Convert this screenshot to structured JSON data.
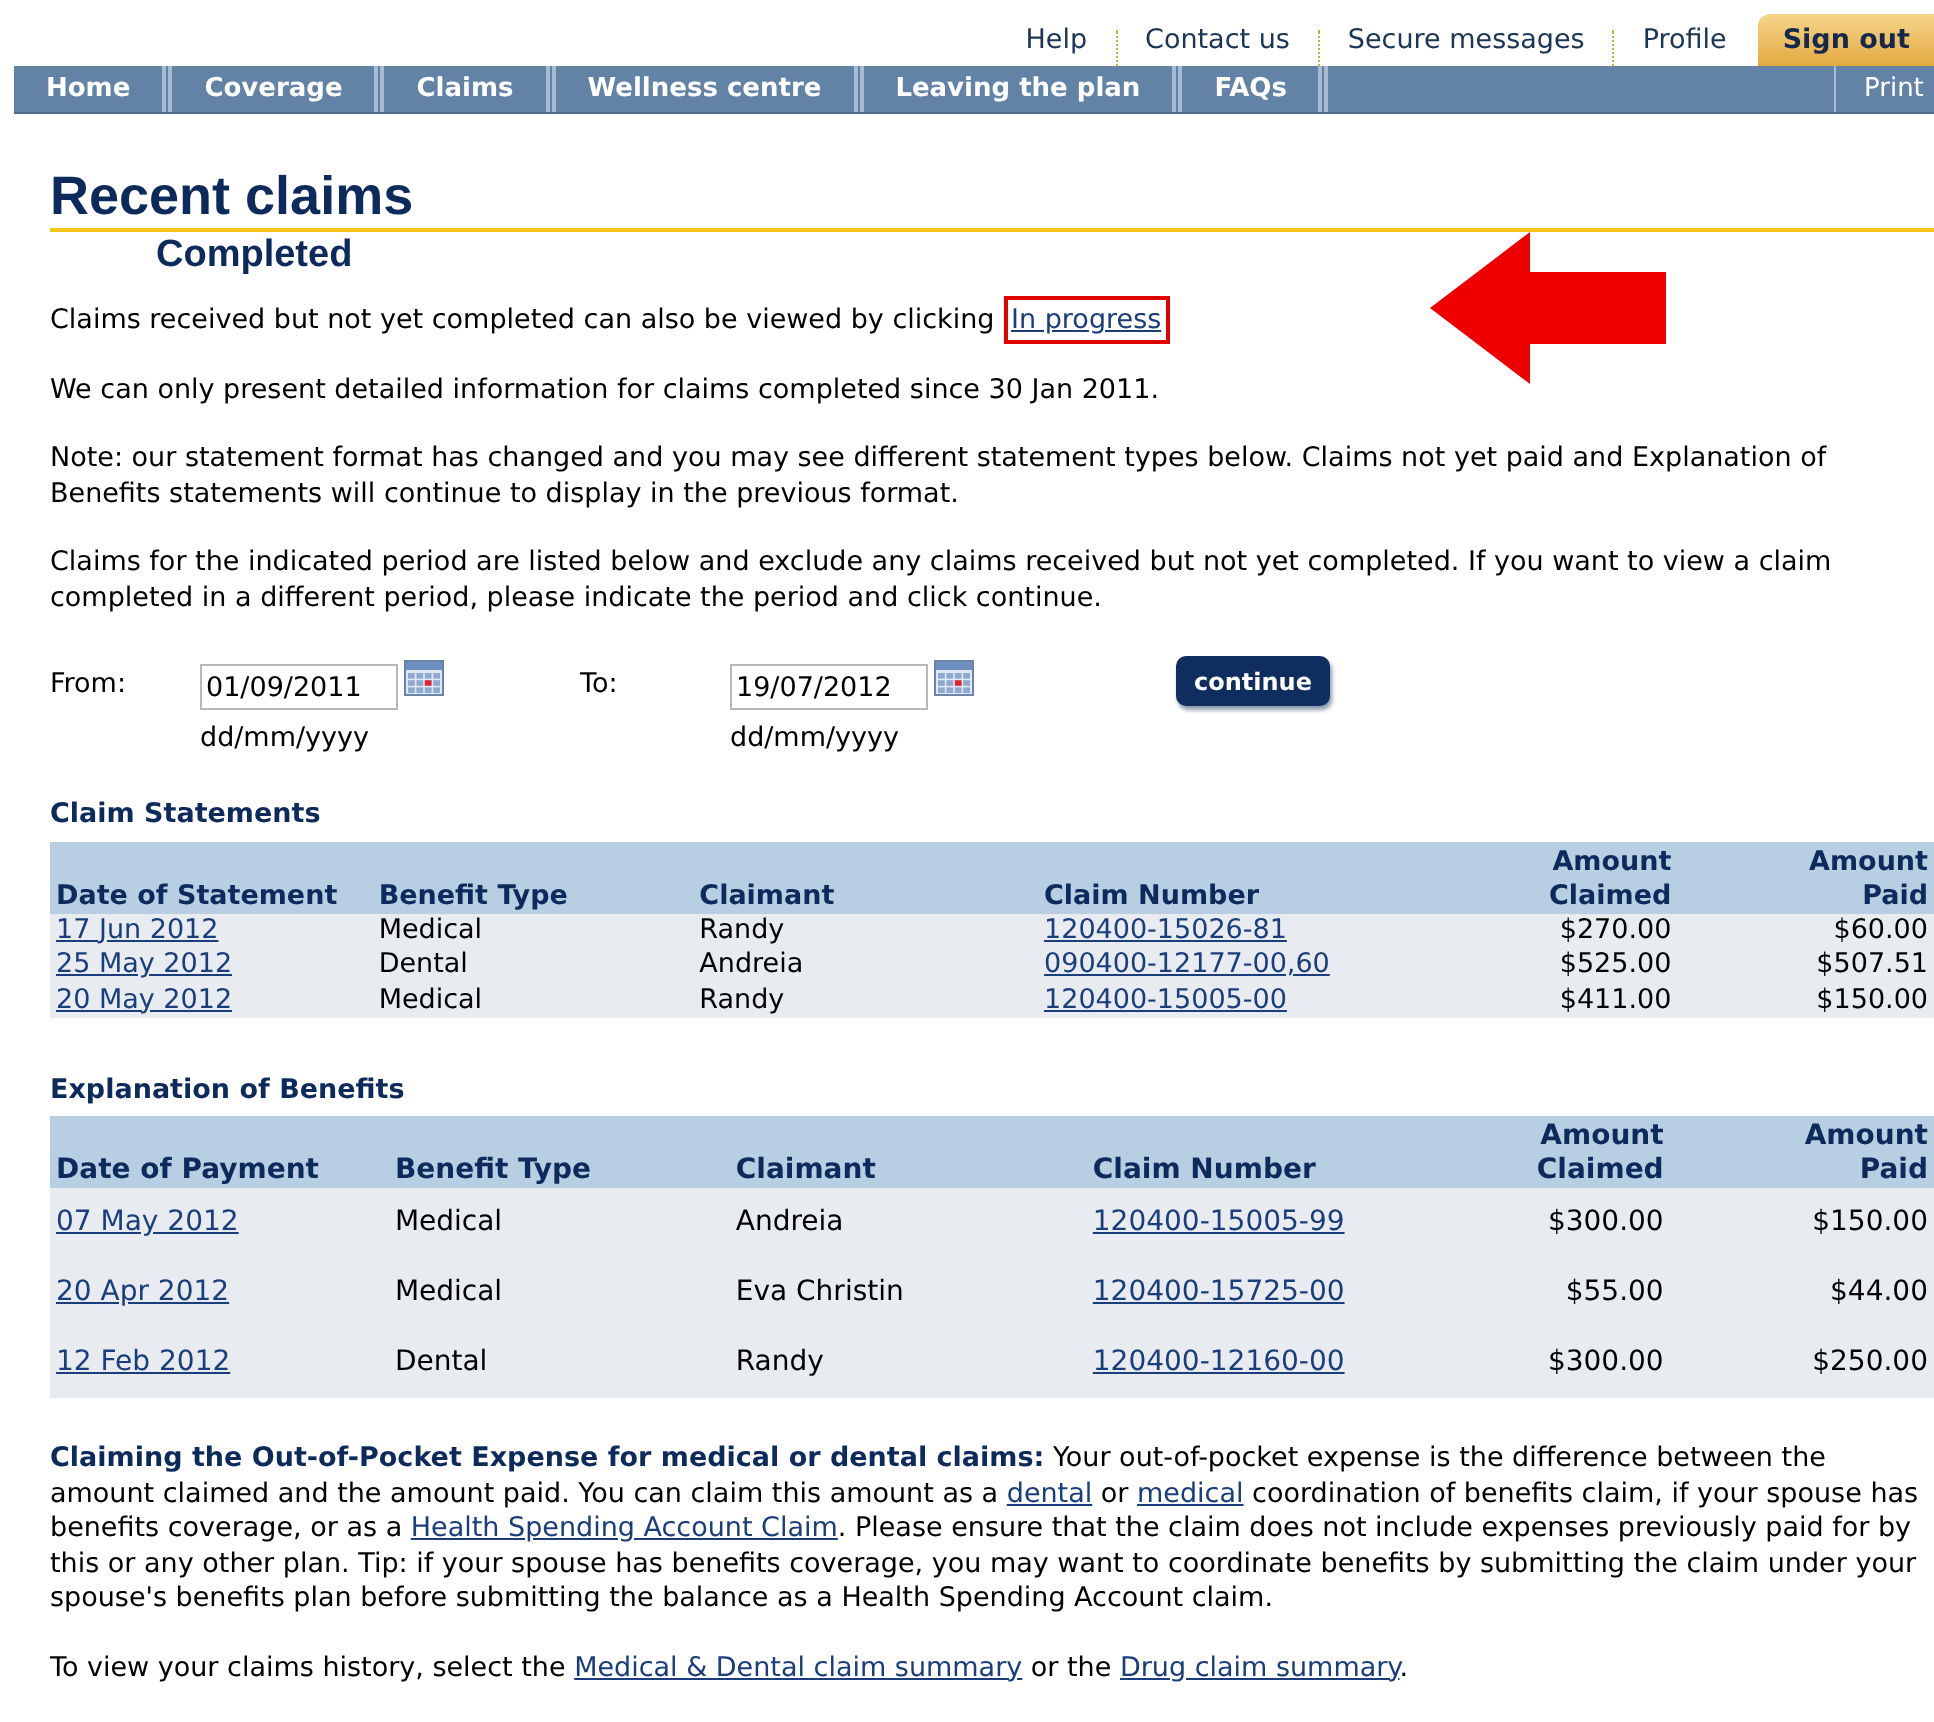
{
  "top_links": [
    {
      "label": "Help",
      "selected": false
    },
    {
      "label": "Contact us",
      "selected": false
    },
    {
      "label": "Secure messages",
      "selected": false
    },
    {
      "label": "Profile",
      "selected": false
    },
    {
      "label": "Sign out",
      "selected": true
    }
  ],
  "nav": {
    "items": [
      "Home",
      "Coverage",
      "Claims",
      "Wellness centre",
      "Leaving the plan",
      "FAQs"
    ],
    "print": "Print"
  },
  "title": "Recent claims",
  "subtitle": "Completed",
  "intro": [
    [
      {
        "kind": "text",
        "text": "Claims received but not yet completed can also be viewed by clicking "
      },
      {
        "kind": "link",
        "text": "In progress",
        "highlighted": true
      }
    ],
    [
      {
        "kind": "text",
        "text": "We can only present detailed information for claims completed since 30 Jan 2011."
      }
    ],
    [
      {
        "kind": "text",
        "text": "Note: our statement format has changed and you may see different statement types below. Claims not yet paid and Explanation of Benefits statements will continue to display in the previous format."
      }
    ],
    [
      {
        "kind": "text",
        "text": "Claims for the indicated period are listed below and exclude any claims received but not yet completed. If you want to view a claim completed in a different period, please indicate the period and click continue."
      }
    ]
  ],
  "period": {
    "from": {
      "label": "From:",
      "value": "01/09/2011",
      "hint": "dd/mm/yyyy"
    },
    "to": {
      "label": "To:",
      "value": "19/07/2012",
      "hint": "dd/mm/yyyy"
    },
    "button": "continue"
  },
  "claim_statements": {
    "title": "Claim Statements",
    "columns": [
      "Date of Statement",
      "Benefit Type",
      "Claimant",
      "Claim Number",
      "Amount Claimed",
      "Amount Paid"
    ],
    "rows": [
      [
        "17 Jun 2012",
        "Medical",
        "Randy",
        "120400-15026-81",
        "$270.00",
        "$60.00"
      ],
      [
        "25 May 2012",
        "Dental",
        "Andreia",
        "090400-12177-00,60",
        "$525.00",
        "$507.51"
      ],
      [
        "20 May 2012",
        "Medical",
        "Randy",
        "120400-15005-00",
        "$411.00",
        "$150.00"
      ]
    ]
  },
  "explanation_of_benefits": {
    "title": "Explanation of Benefits",
    "columns": [
      "Date of Payment",
      "Benefit Type",
      "Claimant",
      "Claim Number",
      "Amount Claimed",
      "Amount Paid"
    ],
    "rows": [
      [
        "07 May 2012",
        "Medical",
        "Andreia",
        "120400-15005-99",
        "$300.00",
        "$150.00"
      ],
      [
        "20 Apr 2012",
        "Medical",
        "Eva Christin",
        "120400-15725-00",
        "$55.00",
        "$44.00"
      ],
      [
        "12 Feb 2012",
        "Dental",
        "Randy",
        "120400-12160-00",
        "$300.00",
        "$250.00"
      ]
    ]
  },
  "footer": [
    [
      {
        "kind": "bold",
        "text": "Claiming the Out-of-Pocket Expense for medical or dental claims:"
      },
      {
        "kind": "text",
        "text": " Your out-of-pocket expense is the difference between the amount claimed and the amount paid. You can claim this amount as a "
      },
      {
        "kind": "link",
        "text": "dental"
      },
      {
        "kind": "text",
        "text": " or "
      },
      {
        "kind": "link",
        "text": "medical"
      },
      {
        "kind": "text",
        "text": " coordination of benefits claim, if your spouse has benefits coverage, or as a "
      },
      {
        "kind": "link",
        "text": "Health Spending Account Claim"
      },
      {
        "kind": "text",
        "text": ". Please ensure that the claim does not include expenses previously paid for by this or any other plan. Tip: if your spouse has benefits coverage, you may want to coordinate benefits by submitting the claim under your spouse's benefits plan before submitting the balance as a Health Spending Account claim."
      }
    ],
    [
      {
        "kind": "text",
        "text": "To view your claims history, select the "
      },
      {
        "kind": "link",
        "text": "Medical & Dental claim summary"
      },
      {
        "kind": "text",
        "text": " or the "
      },
      {
        "kind": "link",
        "text": "Drug claim summary"
      },
      {
        "kind": "text",
        "text": "."
      }
    ]
  ]
}
